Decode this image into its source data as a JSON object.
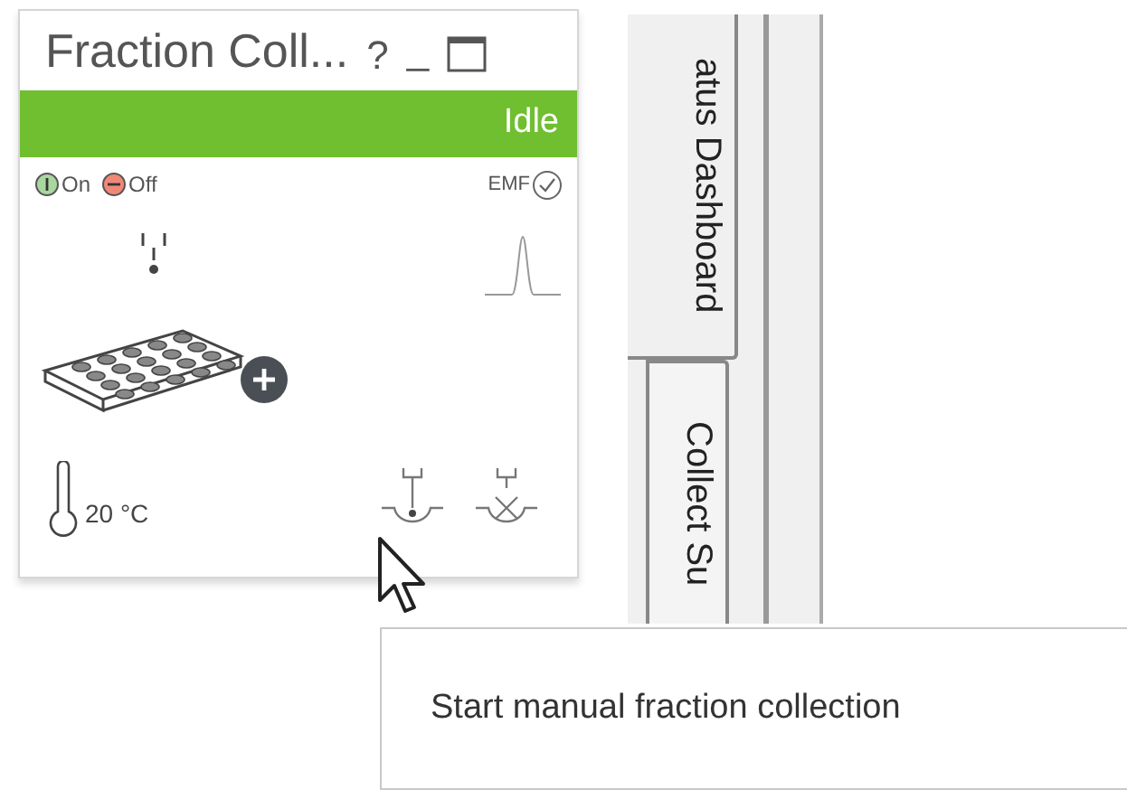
{
  "panel": {
    "title": "Fraction Coll...",
    "help": "?",
    "minimize": "_",
    "status": {
      "label": "Idle",
      "color": "#6fbf30"
    },
    "controls": [
      {
        "label": "On",
        "kind": "on"
      },
      {
        "label": "Off",
        "kind": "off"
      }
    ],
    "emf": {
      "label": "EMF",
      "checked": true
    },
    "temperature": "20 °C"
  },
  "tabs": [
    {
      "label": "atus Dashboard",
      "selected": true
    },
    {
      "label": "Collect Su",
      "selected": false
    }
  ],
  "tooltip": "Start manual fraction collection"
}
